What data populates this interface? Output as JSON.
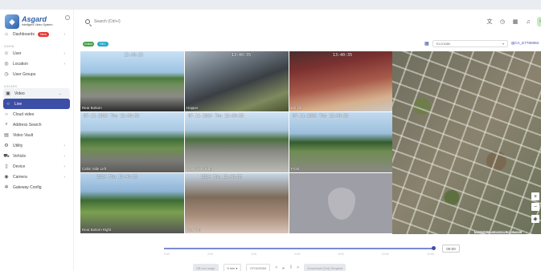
{
  "app": {
    "title": "Asgard",
    "subtitle": "Intelligent Video System"
  },
  "search": {
    "placeholder": "Search (Ctrl+/)"
  },
  "sidebar": {
    "dashboard": {
      "label": "Dashboards",
      "badge": "New"
    },
    "section_admin": "ADMIN",
    "admin_items": [
      {
        "label": "User"
      },
      {
        "label": "Location"
      },
      {
        "label": "User Groups"
      }
    ],
    "section_asgard": "ASGARD",
    "video": {
      "label": "Video"
    },
    "video_children": [
      {
        "label": "Live"
      },
      {
        "label": "Cloud video"
      }
    ],
    "asgard_items": [
      {
        "label": "Address Search"
      },
      {
        "label": "Video Vault"
      },
      {
        "label": "Utility"
      },
      {
        "label": "Vehicle"
      },
      {
        "label": "Device"
      },
      {
        "label": "Camera"
      },
      {
        "label": "Gateway Config"
      }
    ]
  },
  "status": {
    "online": "Online",
    "recording": "REC"
  },
  "device": {
    "select_value": "ELO1080",
    "id": "CA_E7760084"
  },
  "cameras": [
    {
      "label": "Rear Bottom",
      "timestamp": "13:40:35"
    },
    {
      "label": "Hopper",
      "timestamp": "13:40:35"
    },
    {
      "label": "Bin Lift",
      "timestamp": "13:40:35"
    },
    {
      "label": "Cabin Side Left",
      "timestamp": "07-11-2024 Thu 13:40:35"
    },
    {
      "label": "Cabin Side Right",
      "timestamp": "07-11-2024 Thu 13:40:35"
    },
    {
      "label": "Front",
      "timestamp": "07-11-2024 Thu 13:40:35"
    },
    {
      "label": "Rear Bottom Right",
      "timestamp": "2024 Thu 13:40:35"
    },
    {
      "label": "Rear Top",
      "timestamp": "2024 Thu 13:40:35"
    }
  ],
  "map": {
    "attribution": "Terms of use  © 2017-2024 HERE, Maxar PTFEO"
  },
  "timeline": {
    "ticks": [
      "0:00",
      "2:00",
      "4:00",
      "6:00",
      "8:00",
      "10:00",
      "12:00"
    ],
    "current_time": "00:00",
    "prev_button": "Off our range",
    "interval": "5 min",
    "date": "07/11/2024",
    "download_button": "Download (Get) Request"
  }
}
